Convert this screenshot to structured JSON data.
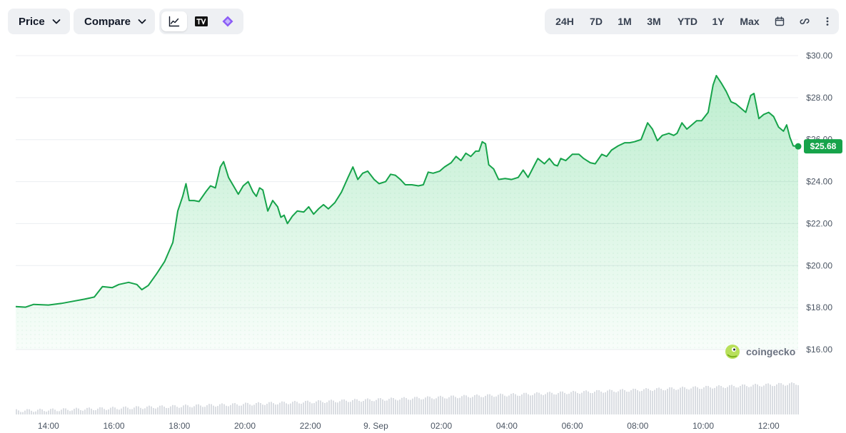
{
  "toolbar": {
    "price_label": "Price",
    "compare_label": "Compare",
    "tools": [
      {
        "name": "line-chart-icon",
        "active": true
      },
      {
        "name": "tradingview-icon",
        "active": false
      },
      {
        "name": "diamond-icon",
        "active": false
      }
    ],
    "ranges": [
      "24H",
      "7D",
      "1M",
      "3M",
      "YTD",
      "1Y",
      "Max"
    ],
    "active_range": "24H",
    "extra_icons": [
      "calendar-icon",
      "link-icon",
      "more-vertical-icon"
    ]
  },
  "watermark": "coingecko",
  "colors": {
    "line": "#16a34a",
    "fill": "#22c55e",
    "price_badge": "#16a34a",
    "volume": "#d1d5db"
  },
  "chart_data": {
    "type": "area",
    "title": "",
    "xlabel": "",
    "ylabel": "",
    "ylim": [
      16,
      30
    ],
    "y_ticks": [
      "$16.00",
      "$18.00",
      "$20.00",
      "$22.00",
      "$24.00",
      "$26.00",
      "$28.00",
      "$30.00"
    ],
    "y_tick_values": [
      16,
      18,
      20,
      22,
      24,
      26,
      28,
      30
    ],
    "x_ticks": [
      "14:00",
      "16:00",
      "18:00",
      "20:00",
      "22:00",
      "9. Sep",
      "02:00",
      "04:00",
      "06:00",
      "08:00",
      "10:00",
      "12:00"
    ],
    "x_tick_hours": [
      14,
      16,
      18,
      20,
      22,
      24,
      26,
      28,
      30,
      32,
      34,
      36
    ],
    "x_range_hours": [
      13.0,
      36.9
    ],
    "current_price_label": "$25.68",
    "current_price": 25.68,
    "series": [
      {
        "points": [
          [
            13.0,
            18.05
          ],
          [
            13.3,
            18.02
          ],
          [
            13.55,
            18.15
          ],
          [
            14.0,
            18.12
          ],
          [
            14.4,
            18.2
          ],
          [
            14.75,
            18.3
          ],
          [
            15.1,
            18.4
          ],
          [
            15.4,
            18.5
          ],
          [
            15.65,
            19.0
          ],
          [
            15.95,
            18.95
          ],
          [
            16.15,
            19.1
          ],
          [
            16.45,
            19.2
          ],
          [
            16.7,
            19.1
          ],
          [
            16.85,
            18.85
          ],
          [
            17.05,
            19.05
          ],
          [
            17.3,
            19.6
          ],
          [
            17.55,
            20.2
          ],
          [
            17.8,
            21.1
          ],
          [
            17.95,
            22.6
          ],
          [
            18.1,
            23.3
          ],
          [
            18.2,
            23.9
          ],
          [
            18.3,
            23.1
          ],
          [
            18.45,
            23.1
          ],
          [
            18.6,
            23.05
          ],
          [
            18.8,
            23.5
          ],
          [
            18.95,
            23.8
          ],
          [
            19.1,
            23.7
          ],
          [
            19.25,
            24.7
          ],
          [
            19.35,
            24.95
          ],
          [
            19.5,
            24.2
          ],
          [
            19.65,
            23.8
          ],
          [
            19.8,
            23.4
          ],
          [
            19.95,
            23.8
          ],
          [
            20.1,
            24.0
          ],
          [
            20.25,
            23.5
          ],
          [
            20.35,
            23.3
          ],
          [
            20.45,
            23.7
          ],
          [
            20.55,
            23.6
          ],
          [
            20.7,
            22.6
          ],
          [
            20.85,
            23.1
          ],
          [
            21.0,
            22.8
          ],
          [
            21.1,
            22.3
          ],
          [
            21.2,
            22.4
          ],
          [
            21.3,
            22.0
          ],
          [
            21.45,
            22.35
          ],
          [
            21.6,
            22.6
          ],
          [
            21.8,
            22.55
          ],
          [
            21.95,
            22.8
          ],
          [
            22.1,
            22.45
          ],
          [
            22.25,
            22.7
          ],
          [
            22.4,
            22.9
          ],
          [
            22.55,
            22.7
          ],
          [
            22.75,
            23.0
          ],
          [
            22.95,
            23.5
          ],
          [
            23.15,
            24.2
          ],
          [
            23.3,
            24.7
          ],
          [
            23.45,
            24.1
          ],
          [
            23.6,
            24.4
          ],
          [
            23.75,
            24.5
          ],
          [
            23.95,
            24.1
          ],
          [
            24.1,
            23.9
          ],
          [
            24.3,
            24.0
          ],
          [
            24.45,
            24.35
          ],
          [
            24.6,
            24.3
          ],
          [
            24.75,
            24.1
          ],
          [
            24.9,
            23.85
          ],
          [
            25.1,
            23.85
          ],
          [
            25.3,
            23.8
          ],
          [
            25.45,
            23.85
          ],
          [
            25.6,
            24.45
          ],
          [
            25.75,
            24.4
          ],
          [
            25.95,
            24.5
          ],
          [
            26.1,
            24.7
          ],
          [
            26.3,
            24.9
          ],
          [
            26.45,
            25.2
          ],
          [
            26.6,
            25.0
          ],
          [
            26.75,
            25.35
          ],
          [
            26.9,
            25.2
          ],
          [
            27.05,
            25.45
          ],
          [
            27.15,
            25.45
          ],
          [
            27.25,
            25.9
          ],
          [
            27.35,
            25.8
          ],
          [
            27.45,
            24.8
          ],
          [
            27.6,
            24.6
          ],
          [
            27.75,
            24.1
          ],
          [
            27.95,
            24.15
          ],
          [
            28.15,
            24.1
          ],
          [
            28.35,
            24.2
          ],
          [
            28.5,
            24.55
          ],
          [
            28.65,
            24.2
          ],
          [
            28.85,
            24.8
          ],
          [
            28.95,
            25.1
          ],
          [
            29.15,
            24.85
          ],
          [
            29.3,
            25.1
          ],
          [
            29.45,
            24.8
          ],
          [
            29.55,
            24.75
          ],
          [
            29.65,
            25.1
          ],
          [
            29.8,
            25.0
          ],
          [
            30.0,
            25.3
          ],
          [
            30.2,
            25.3
          ],
          [
            30.35,
            25.1
          ],
          [
            30.55,
            24.9
          ],
          [
            30.7,
            24.85
          ],
          [
            30.9,
            25.3
          ],
          [
            31.05,
            25.2
          ],
          [
            31.2,
            25.5
          ],
          [
            31.4,
            25.7
          ],
          [
            31.6,
            25.85
          ],
          [
            31.75,
            25.85
          ],
          [
            31.9,
            25.9
          ],
          [
            32.1,
            26.0
          ],
          [
            32.3,
            26.8
          ],
          [
            32.45,
            26.5
          ],
          [
            32.6,
            25.95
          ],
          [
            32.75,
            26.2
          ],
          [
            32.95,
            26.3
          ],
          [
            33.1,
            26.2
          ],
          [
            33.2,
            26.3
          ],
          [
            33.35,
            26.8
          ],
          [
            33.5,
            26.5
          ],
          [
            33.65,
            26.7
          ],
          [
            33.8,
            26.9
          ],
          [
            33.95,
            26.9
          ],
          [
            34.15,
            27.3
          ],
          [
            34.3,
            28.6
          ],
          [
            34.4,
            29.05
          ],
          [
            34.55,
            28.7
          ],
          [
            34.7,
            28.3
          ],
          [
            34.85,
            27.8
          ],
          [
            35.0,
            27.7
          ],
          [
            35.15,
            27.5
          ],
          [
            35.3,
            27.3
          ],
          [
            35.45,
            28.1
          ],
          [
            35.55,
            28.2
          ],
          [
            35.7,
            27.0
          ],
          [
            35.85,
            27.2
          ],
          [
            36.0,
            27.3
          ],
          [
            36.15,
            27.1
          ],
          [
            36.3,
            26.6
          ],
          [
            36.45,
            26.4
          ],
          [
            36.55,
            26.7
          ],
          [
            36.65,
            26.1
          ],
          [
            36.75,
            25.7
          ],
          [
            36.9,
            25.68
          ]
        ]
      }
    ]
  }
}
